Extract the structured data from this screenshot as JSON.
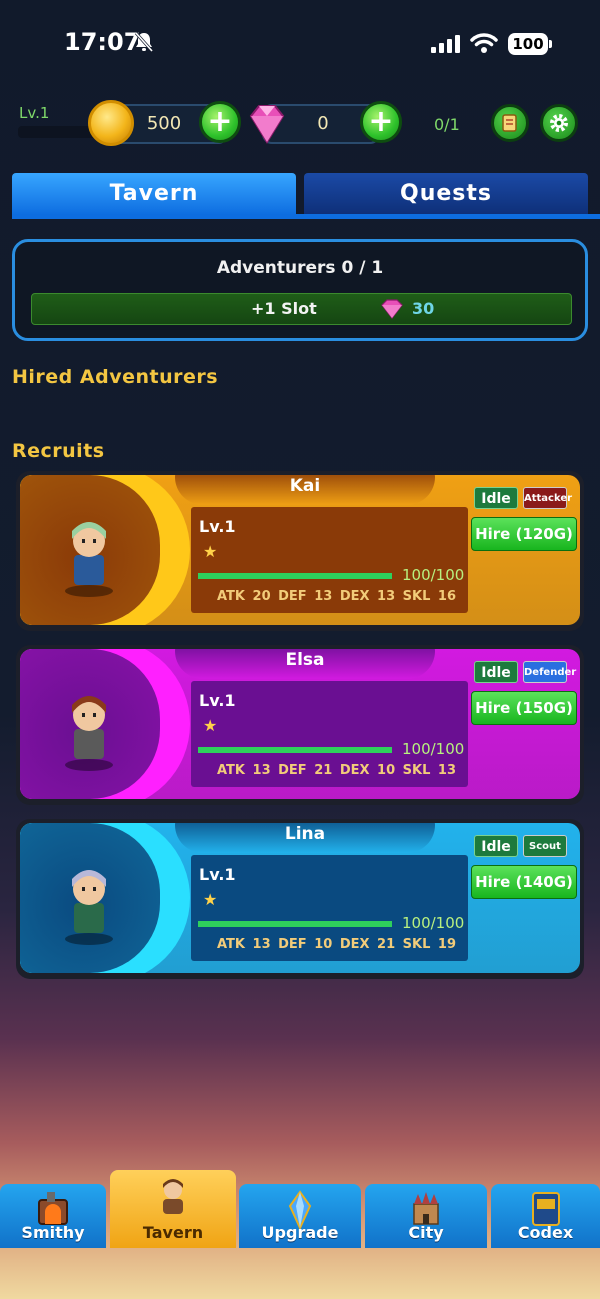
{
  "status_bar": {
    "time": "17:07",
    "battery": "100"
  },
  "hud": {
    "level": "Lv.1",
    "gold": "500",
    "gems": "0",
    "adventurer_slots": "0/1"
  },
  "tabs": [
    {
      "label": "Tavern",
      "active": true
    },
    {
      "label": "Quests",
      "active": false
    }
  ],
  "adventurers_panel": {
    "title": "Adventurers 0 / 1",
    "slot_button_label": "+1 Slot",
    "slot_cost": "30"
  },
  "sections": {
    "hired": "Hired Adventurers",
    "recruits": "Recruits"
  },
  "recruits": [
    {
      "name": "Kai",
      "level": "Lv.1",
      "hp": "100/100",
      "hp_fraction": 1.0,
      "stats": "ATK 20 DEF 13 DEX 13 SKL 16",
      "status": "Idle",
      "role": "Attacker",
      "hire_label": "Hire (120G)",
      "theme_color": "#f0a014",
      "stat_box_color": "#8a3a08",
      "role_color": "#8a1a1a"
    },
    {
      "name": "Elsa",
      "level": "Lv.1",
      "hp": "100/100",
      "hp_fraction": 1.0,
      "stats": "ATK 13 DEF 21 DEX 10 SKL 13",
      "status": "Idle",
      "role": "Defender",
      "hire_label": "Hire (150G)",
      "theme_color": "#d21ae0",
      "stat_box_color": "#6a0f92",
      "role_color": "#2a6fe0"
    },
    {
      "name": "Lina",
      "level": "Lv.1",
      "hp": "100/100",
      "hp_fraction": 1.0,
      "stats": "ATK 13 DEF 10 DEX 21 SKL 19",
      "status": "Idle",
      "role": "Scout",
      "hire_label": "Hire (140G)",
      "theme_color": "#22b2ec",
      "stat_box_color": "#0a4a80",
      "role_color": "#1d7a3d"
    }
  ],
  "nav": [
    {
      "label": "Smithy",
      "icon": "forge-icon",
      "active": false
    },
    {
      "label": "Tavern",
      "icon": "adventurer-icon",
      "active": true
    },
    {
      "label": "Upgrade",
      "icon": "crystal-icon",
      "active": false
    },
    {
      "label": "City",
      "icon": "castle-icon",
      "active": false
    },
    {
      "label": "Codex",
      "icon": "book-icon",
      "active": false
    }
  ]
}
